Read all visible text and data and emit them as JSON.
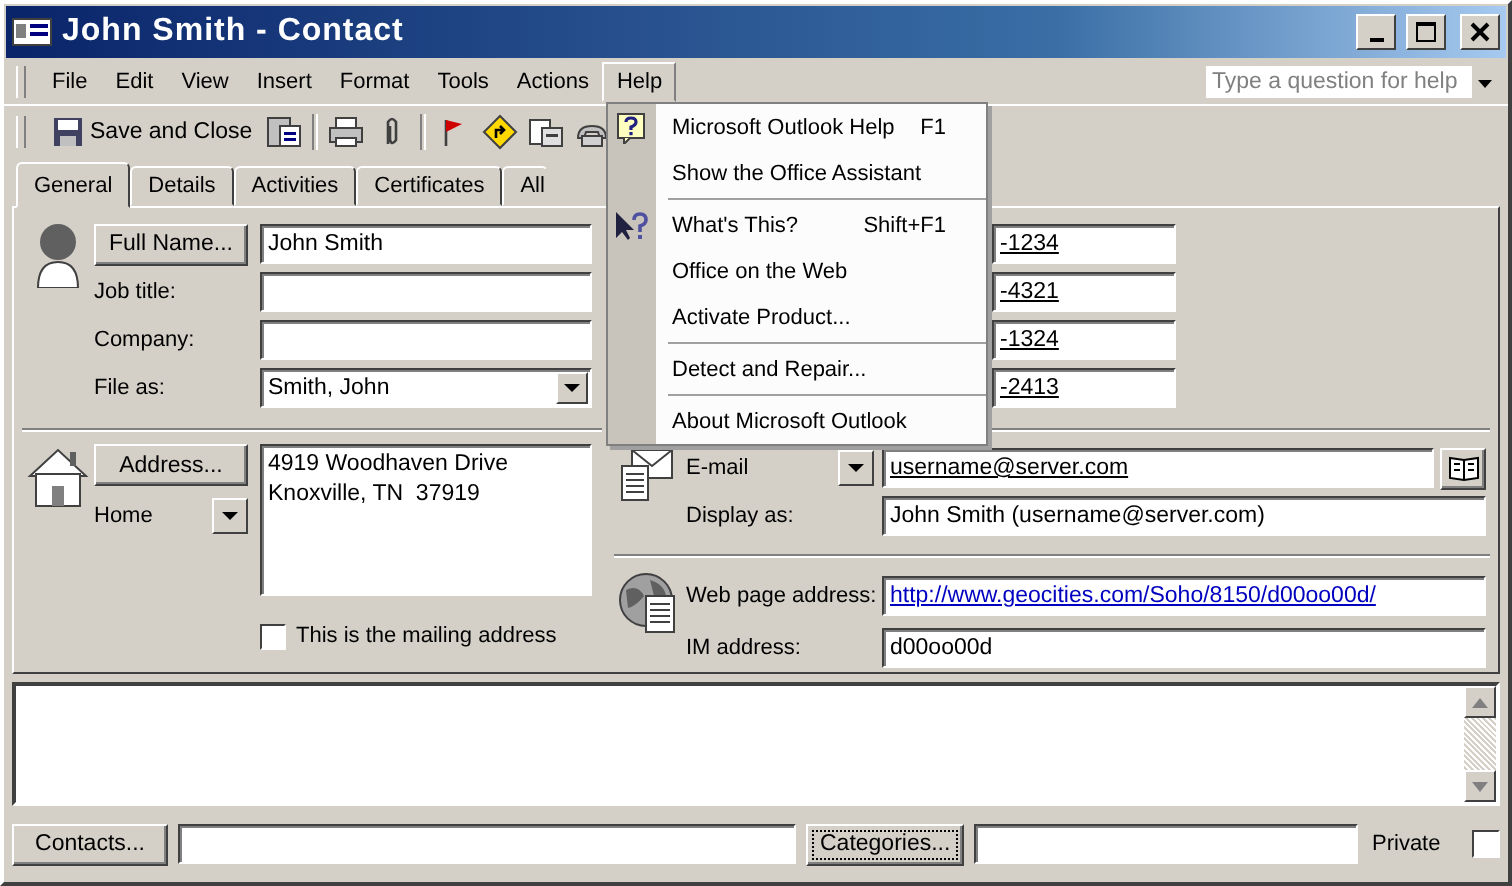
{
  "window": {
    "title": "John Smith - Contact"
  },
  "menu_bar": [
    {
      "label": "File",
      "selected": false
    },
    {
      "label": "Edit",
      "selected": false
    },
    {
      "label": "View",
      "selected": false
    },
    {
      "label": "Insert",
      "selected": false
    },
    {
      "label": "Format",
      "selected": false
    },
    {
      "label": "Tools",
      "selected": false
    },
    {
      "label": "Actions",
      "selected": false
    },
    {
      "label": "Help",
      "selected": true
    }
  ],
  "help_box": {
    "placeholder": "Type a question for help"
  },
  "toolbar": {
    "save_label": "Save and Close"
  },
  "tabs": [
    {
      "label": "General",
      "selected": true
    },
    {
      "label": "Details",
      "selected": false
    },
    {
      "label": "Activities",
      "selected": false
    },
    {
      "label": "Certificates",
      "selected": false
    },
    {
      "label": "All",
      "selected": false
    }
  ],
  "help_menu": [
    {
      "kind": "help-item",
      "label": "Microsoft Outlook Help",
      "shortcut": "F1"
    },
    {
      "kind": "item",
      "label": "Show the Office Assistant"
    },
    {
      "kind": "separator"
    },
    {
      "kind": "pointer-item",
      "label": "What's This?",
      "shortcut": "Shift+F1"
    },
    {
      "kind": "item",
      "label": "Office on the Web"
    },
    {
      "kind": "item",
      "label": "Activate Product..."
    },
    {
      "kind": "separator"
    },
    {
      "kind": "item",
      "label": "Detect and Repair..."
    },
    {
      "kind": "separator"
    },
    {
      "kind": "item",
      "label": "About Microsoft Outlook"
    }
  ],
  "name_section": {
    "full_name_button": "Full Name...",
    "full_name": "John Smith",
    "fields": [
      {
        "kind": "text",
        "label": "Job title:"
      },
      {
        "kind": "text",
        "label": "Company:"
      },
      {
        "kind": "dropdown",
        "label": "File as:",
        "value": "Smith, John"
      }
    ]
  },
  "address": {
    "button": "Address...",
    "type": "Home",
    "text": "4919 Woodhaven Drive\nKnoxville, TN  37919",
    "mailing_label": "This is the mailing address",
    "mailing_checked": false
  },
  "phones": [
    "-1234",
    "-4321",
    "-1324",
    "-2413"
  ],
  "email": {
    "label": "E-mail",
    "value": "username@server.com"
  },
  "display_as": {
    "label": "Display as:",
    "value": "John Smith (username@server.com)"
  },
  "web": {
    "label": "Web page address:",
    "value": "http://www.geocities.com/Soho/8150/d00oo00d/"
  },
  "im": {
    "label": "IM address:",
    "value": "d00oo00d"
  },
  "bottom": {
    "contacts_button": "Contacts...",
    "categories_button": "Categories...",
    "private_label": "Private",
    "private_checked": false
  }
}
